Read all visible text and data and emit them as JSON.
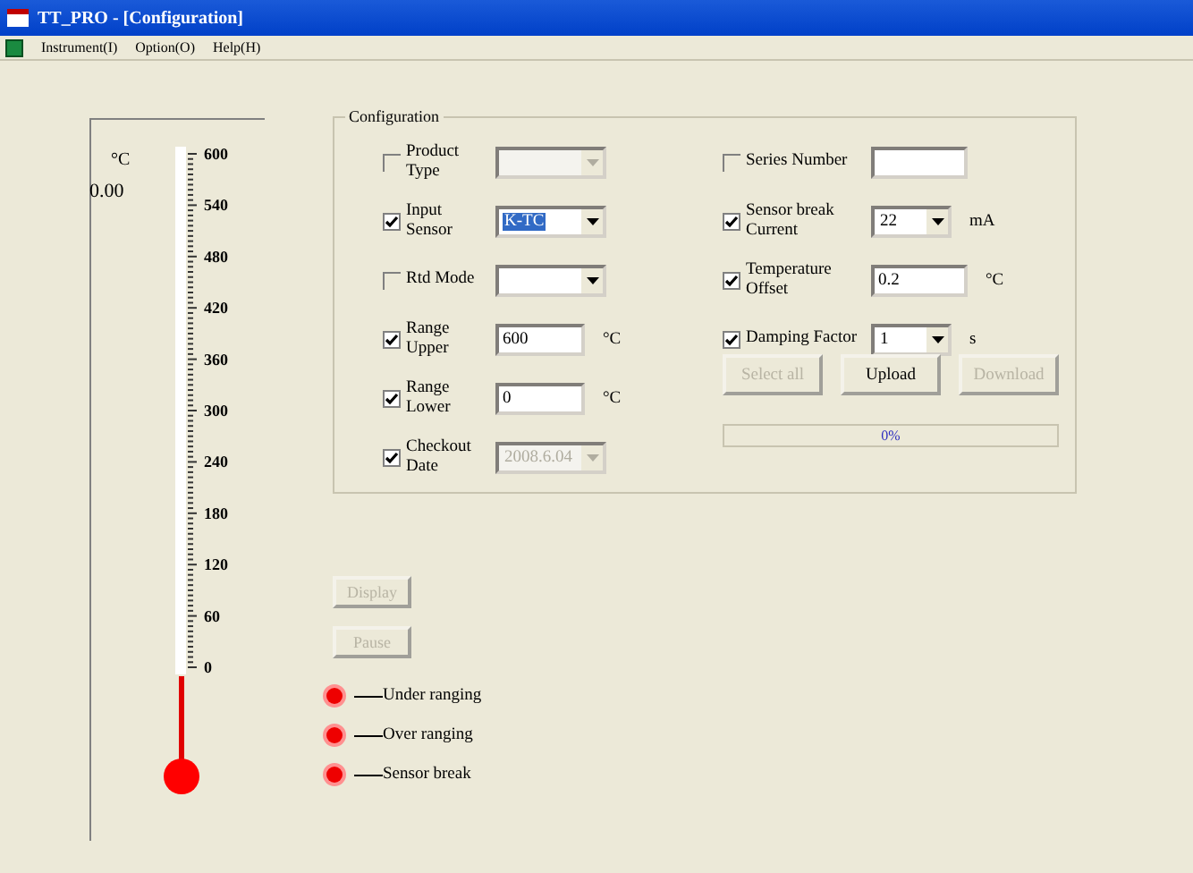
{
  "window": {
    "title": "TT_PRO - [Configuration]"
  },
  "menu": [
    "Instrument(I)",
    "Option(O)",
    "Help(H)"
  ],
  "thermometer": {
    "unit": "°C",
    "reading": "0.00",
    "scale": [
      "600",
      "540",
      "480",
      "420",
      "360",
      "300",
      "240",
      "180",
      "120",
      "60",
      "0"
    ]
  },
  "configuration": {
    "title": "Configuration",
    "left": [
      {
        "label": "Product Type",
        "checked": false,
        "kind": "combo",
        "disabled": true
      },
      {
        "label": "Input Sensor",
        "checked": true,
        "kind": "combo",
        "value": "K-TC",
        "disabled": false,
        "highlighted": true
      },
      {
        "label": "Rtd Mode",
        "checked": false,
        "kind": "combo",
        "disabled": false
      },
      {
        "label": "Range Upper",
        "checked": true,
        "kind": "text",
        "value": "600",
        "unit": "°C"
      },
      {
        "label": "Range Lower",
        "checked": true,
        "kind": "text",
        "value": "0",
        "unit": "°C"
      },
      {
        "label": "Checkout Date",
        "checked": true,
        "kind": "combo",
        "value": "2008.6.04",
        "disabled": true,
        "highlighted": false
      }
    ],
    "right": [
      {
        "label": "Series Number",
        "checked": false,
        "kind": "text"
      },
      {
        "label": "Sensor break Current",
        "checked": true,
        "kind": "combo",
        "value": "22",
        "unit": "mA",
        "disabled": false,
        "highlighted": false
      },
      {
        "label": "Temperature Offset",
        "checked": true,
        "kind": "text",
        "value": "0.2",
        "unit": "°C"
      },
      {
        "label": "Damping Factor",
        "checked": true,
        "kind": "combo",
        "value": "1",
        "unit": "s",
        "disabled": false,
        "highlighted": false
      }
    ],
    "buttons": [
      {
        "label": "Select all",
        "disabled": true
      },
      {
        "label": "Upload",
        "disabled": false
      },
      {
        "label": "Download",
        "disabled": true
      }
    ],
    "progress": {
      "label": "0%",
      "level": 0
    }
  },
  "controls": [
    {
      "label": "Display",
      "disabled": true
    },
    {
      "label": "Pause",
      "disabled": true
    }
  ],
  "indicators": [
    {
      "label": "Under ranging",
      "lit": true
    },
    {
      "label": "Over ranging",
      "lit": true
    },
    {
      "label": "Sensor break",
      "lit": true
    }
  ]
}
